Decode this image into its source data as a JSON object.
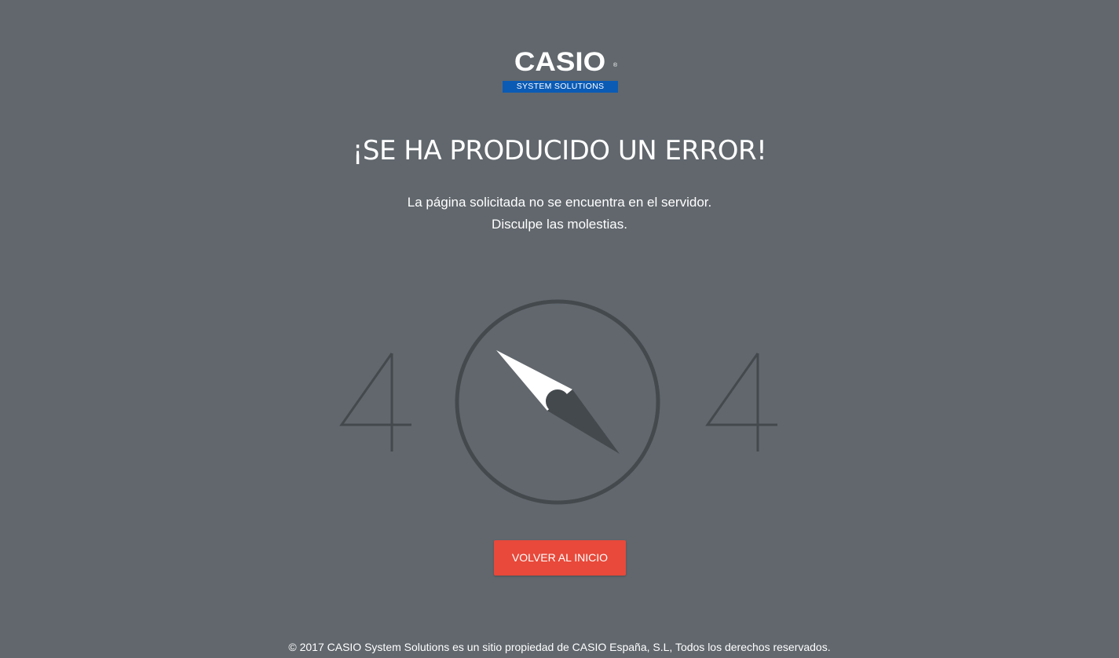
{
  "logo": {
    "wordmark": "CASIO",
    "registered": "®",
    "subtitle": "SYSTEM SOLUTIONS"
  },
  "error": {
    "title": "¡SE HA PRODUCIDO UN ERROR!",
    "message_line1": "La página solicitada no se encuentra en el servidor.",
    "message_line2": "Disculpe las molestias."
  },
  "illustration": {
    "left_digit": "4",
    "right_digit": "4",
    "center_icon": "compass-icon"
  },
  "actions": {
    "back_home_label": "VOLVER AL INICIO"
  },
  "footer": {
    "copyright": "© 2017 CASIO System Solutions es un sitio propiedad de CASIO España, S.L, Todos los derechos reservados."
  },
  "colors": {
    "background": "#61676d",
    "accent_button": "#e8493a",
    "logo_band": "#0b5bb5",
    "illustration_stroke": "#44494d"
  }
}
